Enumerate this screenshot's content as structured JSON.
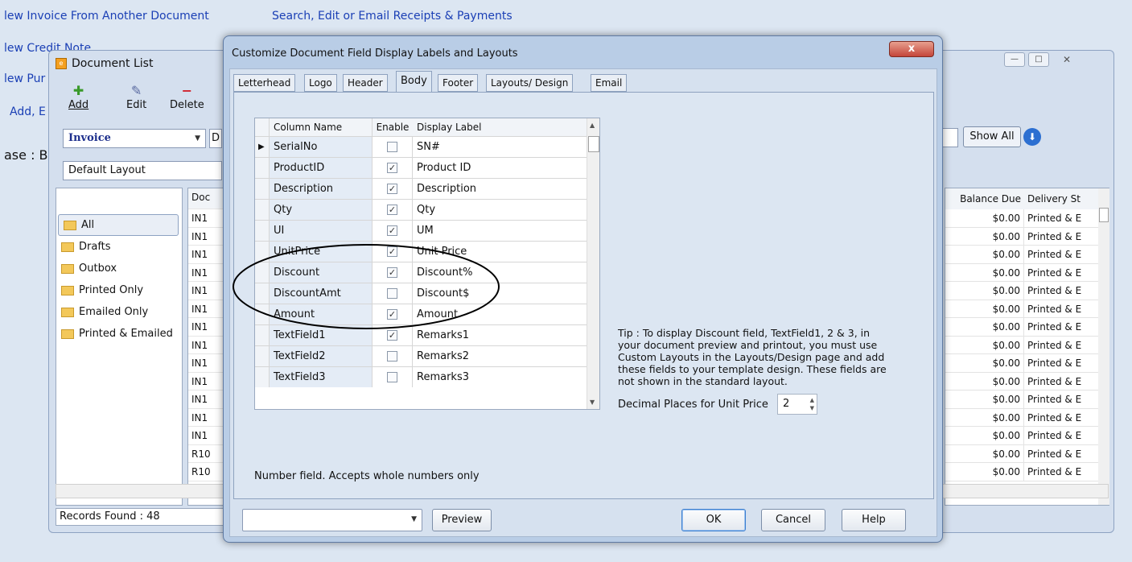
{
  "top_links": {
    "new_invoice_from_doc": "lew Invoice From Another Document",
    "search_receipts": "Search, Edit or Email Receipts & Payments",
    "new_credit_note": "lew Credit Note",
    "new_pur": "lew Pur",
    "add_e": "Add, E",
    "base_label": "ase : B"
  },
  "doclist": {
    "title": "Document List",
    "toolbar": {
      "add": "Add",
      "edit": "Edit",
      "delete": "Delete"
    },
    "doc_type": "Invoice",
    "layout": "Default Layout",
    "show_all": "Show All",
    "folders": [
      "All",
      "Drafts",
      "Outbox",
      "Printed Only",
      "Emailed Only",
      "Printed & Emailed"
    ],
    "doc_col_header": "Doc",
    "doc_col_values": [
      "IN1",
      "IN1",
      "IN1",
      "IN1",
      "IN1",
      "IN1",
      "IN1",
      "IN1",
      "IN1",
      "IN1",
      "IN1",
      "IN1",
      "IN1",
      "R10",
      "R10"
    ],
    "right_headers": {
      "balance_due": "Balance Due",
      "delivery": "Delivery St"
    },
    "right_rows": [
      {
        "balance": "$0.00",
        "status": "Printed & E"
      },
      {
        "balance": "$0.00",
        "status": "Printed & E"
      },
      {
        "balance": "$0.00",
        "status": "Printed & E"
      },
      {
        "balance": "$0.00",
        "status": "Printed & E"
      },
      {
        "balance": "$0.00",
        "status": "Printed & E"
      },
      {
        "balance": "$0.00",
        "status": "Printed & E"
      },
      {
        "balance": "$0.00",
        "status": "Printed & E"
      },
      {
        "balance": "$0.00",
        "status": "Printed & E"
      },
      {
        "balance": "$0.00",
        "status": "Printed & E"
      },
      {
        "balance": "$0.00",
        "status": "Printed & E"
      },
      {
        "balance": "$0.00",
        "status": "Printed & E"
      },
      {
        "balance": "$0.00",
        "status": "Printed & E"
      },
      {
        "balance": "$0.00",
        "status": "Printed & E"
      },
      {
        "balance": "$0.00",
        "status": "Printed & E"
      },
      {
        "balance": "$0.00",
        "status": "Printed & E"
      }
    ],
    "records_found": "Records Found : 48"
  },
  "dialog": {
    "title": "Customize Document Field Display Labels and Layouts",
    "close": "x",
    "tabs": [
      "Letterhead",
      "Logo",
      "Header",
      "Body",
      "Footer",
      "Layouts/ Design",
      "Email"
    ],
    "active_tab": "Body",
    "grid_headers": {
      "column_name": "Column Name",
      "enable": "Enable",
      "display_label": "Display Label"
    },
    "rows": [
      {
        "name": "SerialNo",
        "enabled": false,
        "label": "SN#"
      },
      {
        "name": "ProductID",
        "enabled": true,
        "label": "Product ID"
      },
      {
        "name": "Description",
        "enabled": true,
        "label": "Description"
      },
      {
        "name": "Qty",
        "enabled": true,
        "label": "Qty"
      },
      {
        "name": "UI",
        "enabled": true,
        "label": "UM"
      },
      {
        "name": "UnitPrice",
        "enabled": true,
        "label": "Unit Price"
      },
      {
        "name": "Discount",
        "enabled": true,
        "label": "Discount%"
      },
      {
        "name": "DiscountAmt",
        "enabled": false,
        "label": "Discount$"
      },
      {
        "name": "Amount",
        "enabled": true,
        "label": "Amount"
      },
      {
        "name": "TextField1",
        "enabled": true,
        "label": "Remarks1"
      },
      {
        "name": "TextField2",
        "enabled": false,
        "label": "Remarks2"
      },
      {
        "name": "TextField3",
        "enabled": false,
        "label": "Remarks3"
      }
    ],
    "tip_lines": [
      "Tip : To display Discount field, TextField1, 2 & 3, in",
      "your document preview and printout, you must use",
      "Custom Layouts in the Layouts/Design page and add",
      "these fields to your template design. These fields are",
      "not shown in the standard layout."
    ],
    "decimal_label": "Decimal Places for Unit Price",
    "decimal_value": "2",
    "hint": "Number field. Accepts whole numbers only",
    "buttons": {
      "preview": "Preview",
      "ok": "OK",
      "cancel": "Cancel",
      "help": "Help"
    },
    "bottom_select_value": ""
  }
}
